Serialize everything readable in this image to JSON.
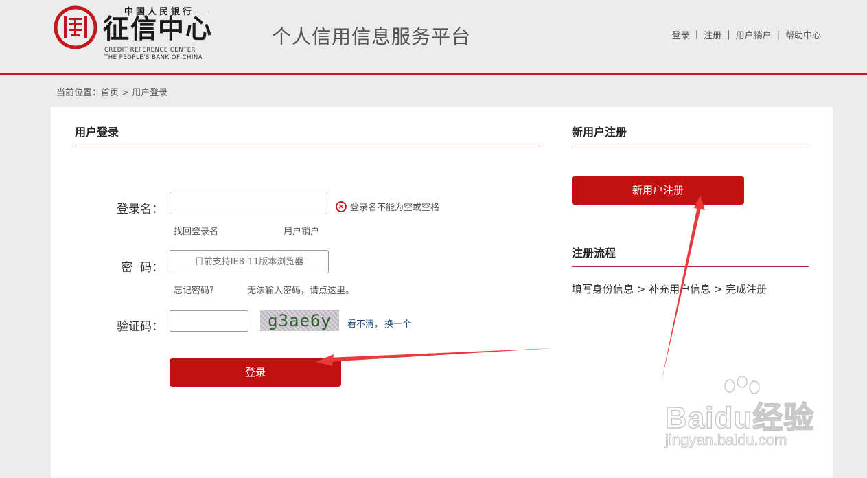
{
  "header": {
    "logo": {
      "top_text": "中国人民银行",
      "main_text": "征信中心",
      "en_line1": "CREDIT REFERENCE CENTER",
      "en_line2": "THE PEOPLE'S BANK OF CHINA"
    },
    "platform_title": "个人信用信息服务平台",
    "nav": [
      {
        "label": "登录"
      },
      {
        "label": "注册"
      },
      {
        "label": "用户销户"
      },
      {
        "label": "帮助中心"
      }
    ],
    "nav_separator": "|"
  },
  "breadcrumb": {
    "prefix": "当前位置：",
    "home": "首页",
    "separator": " > ",
    "current": "用户登录"
  },
  "login": {
    "title": "用户登录",
    "username": {
      "label": "登录名：",
      "value": "",
      "error": "登录名不能为空或空格",
      "links": [
        "找回登录名",
        "用户销户"
      ]
    },
    "password": {
      "label": "密  码：",
      "placeholder": "目前支持IE8-11版本浏览器",
      "links": [
        "忘记密码?",
        "无法输入密码，请点这里。"
      ]
    },
    "captcha": {
      "label": "验证码：",
      "value": "",
      "image_text": "g3ae6y",
      "refresh_prefix": "看不清，",
      "refresh_link": "换一个"
    },
    "submit_label": "登录"
  },
  "register": {
    "title": "新用户注册",
    "button_label": "新用户注册",
    "flow_title": "注册流程",
    "flow_text": "填写身份信息 > 补充用户信息 > 完成注册"
  },
  "watermark": {
    "brand": "Baidu经验",
    "url": "jingyan.baidu.com"
  },
  "colors": {
    "accent_red": "#c0100f",
    "rule_red": "#b8252a",
    "background": "#ececec",
    "link_blue": "#1f4e8c",
    "annotation_arrow": "#e8393b"
  }
}
